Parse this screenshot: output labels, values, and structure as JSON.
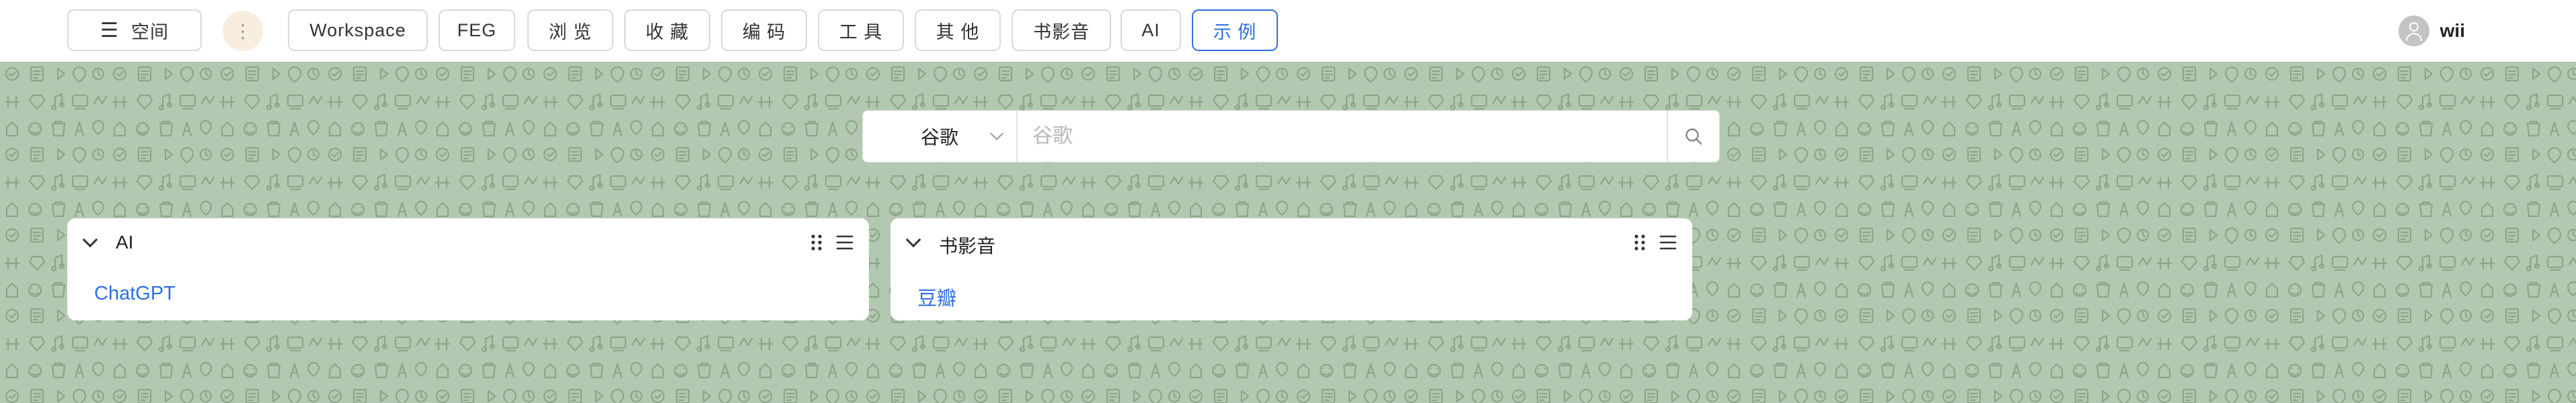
{
  "topbar": {
    "space_label": "空间",
    "more_label": "⋮",
    "nav": [
      {
        "label": "Workspace",
        "active": false
      },
      {
        "label": "FEG",
        "active": false
      },
      {
        "label": "浏 览",
        "active": false
      },
      {
        "label": "收 藏",
        "active": false
      },
      {
        "label": "编 码",
        "active": false
      },
      {
        "label": "工 具",
        "active": false
      },
      {
        "label": "其 他",
        "active": false
      },
      {
        "label": "书影音",
        "active": false
      },
      {
        "label": "AI",
        "active": false
      },
      {
        "label": "示 例",
        "active": true
      }
    ],
    "username": "wii"
  },
  "search": {
    "engine": "谷歌",
    "placeholder": "谷歌"
  },
  "cards": [
    {
      "title": "AI",
      "links": [
        "ChatGPT"
      ]
    },
    {
      "title": "书影音",
      "links": [
        "豆瓣"
      ]
    }
  ],
  "colors": {
    "accent": "#2f6fe4",
    "background": "#b3c8b0",
    "pattern": "#7f9a7c"
  }
}
